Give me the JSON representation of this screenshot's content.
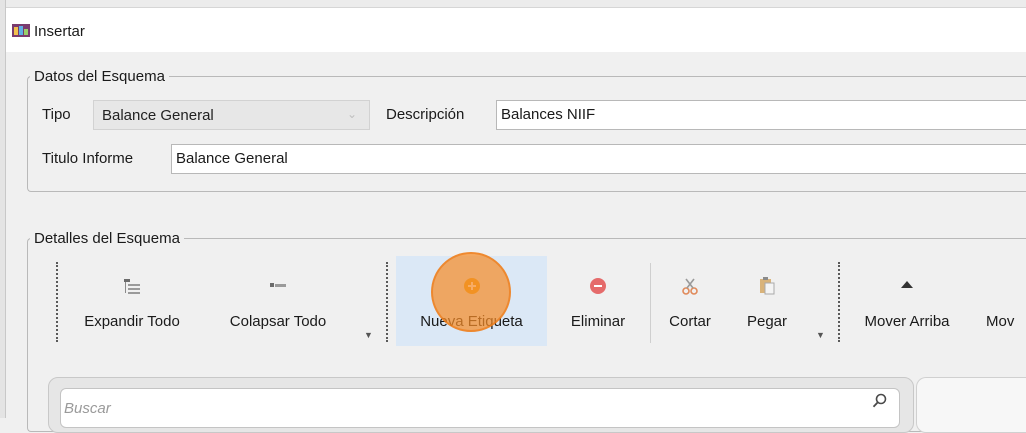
{
  "window": {
    "title": "Insertar",
    "icon": "app-window-icon"
  },
  "datos": {
    "legend": "Datos del Esquema",
    "tipo_label": "Tipo",
    "tipo_value": "Balance General",
    "descripcion_label": "Descripción",
    "descripcion_value": "Balances NIIF",
    "titulo_label": "Titulo Informe",
    "titulo_value": "Balance General"
  },
  "detalles": {
    "legend": "Detalles del Esquema",
    "toolbar": {
      "expand": {
        "label": "Expandir Todo",
        "icon": "expand-all-icon"
      },
      "collapse": {
        "label": "Colapsar Todo",
        "icon": "collapse-all-icon"
      },
      "new_tag": {
        "label": "Nueva Etiqueta",
        "icon": "add-icon"
      },
      "delete": {
        "label": "Eliminar",
        "icon": "remove-icon"
      },
      "cut": {
        "label": "Cortar",
        "icon": "scissors-icon"
      },
      "paste": {
        "label": "Pegar",
        "icon": "paste-icon"
      },
      "move_up": {
        "label": "Mover Arriba",
        "icon": "arrow-up-icon"
      },
      "move_down": {
        "label": "Mov",
        "icon": "arrow-down-icon"
      }
    },
    "search": {
      "placeholder": "Buscar",
      "icon": "search-icon"
    }
  },
  "colors": {
    "highlight": "#dbe8f6",
    "click_indicator": "#f58c28",
    "accent_add": "#e8a317",
    "accent_remove": "#e56b6b"
  }
}
